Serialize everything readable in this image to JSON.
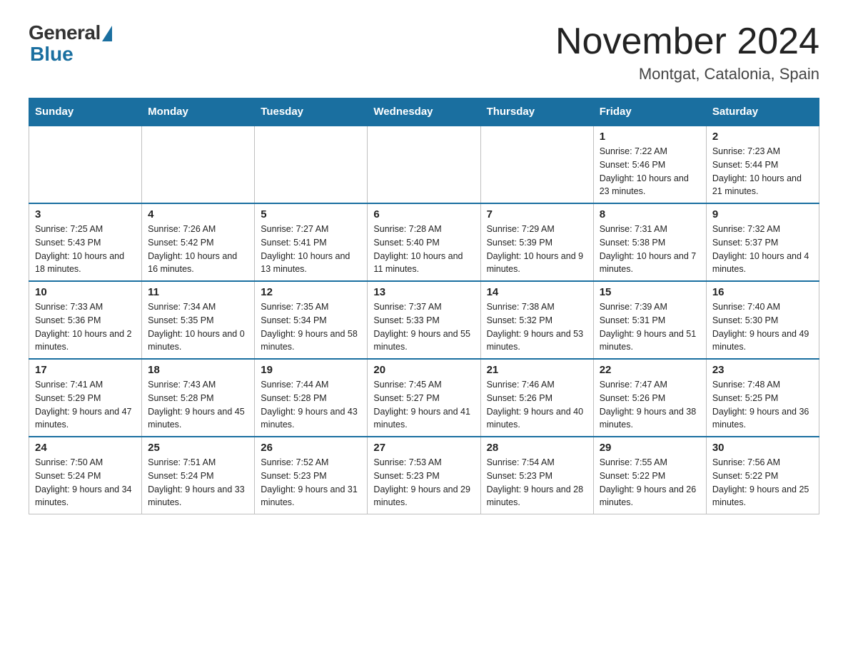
{
  "header": {
    "logo_general": "General",
    "logo_blue": "Blue",
    "main_title": "November 2024",
    "subtitle": "Montgat, Catalonia, Spain"
  },
  "calendar": {
    "days_of_week": [
      "Sunday",
      "Monday",
      "Tuesday",
      "Wednesday",
      "Thursday",
      "Friday",
      "Saturday"
    ],
    "weeks": [
      [
        {
          "day": "",
          "info": ""
        },
        {
          "day": "",
          "info": ""
        },
        {
          "day": "",
          "info": ""
        },
        {
          "day": "",
          "info": ""
        },
        {
          "day": "",
          "info": ""
        },
        {
          "day": "1",
          "info": "Sunrise: 7:22 AM\nSunset: 5:46 PM\nDaylight: 10 hours and 23 minutes."
        },
        {
          "day": "2",
          "info": "Sunrise: 7:23 AM\nSunset: 5:44 PM\nDaylight: 10 hours and 21 minutes."
        }
      ],
      [
        {
          "day": "3",
          "info": "Sunrise: 7:25 AM\nSunset: 5:43 PM\nDaylight: 10 hours and 18 minutes."
        },
        {
          "day": "4",
          "info": "Sunrise: 7:26 AM\nSunset: 5:42 PM\nDaylight: 10 hours and 16 minutes."
        },
        {
          "day": "5",
          "info": "Sunrise: 7:27 AM\nSunset: 5:41 PM\nDaylight: 10 hours and 13 minutes."
        },
        {
          "day": "6",
          "info": "Sunrise: 7:28 AM\nSunset: 5:40 PM\nDaylight: 10 hours and 11 minutes."
        },
        {
          "day": "7",
          "info": "Sunrise: 7:29 AM\nSunset: 5:39 PM\nDaylight: 10 hours and 9 minutes."
        },
        {
          "day": "8",
          "info": "Sunrise: 7:31 AM\nSunset: 5:38 PM\nDaylight: 10 hours and 7 minutes."
        },
        {
          "day": "9",
          "info": "Sunrise: 7:32 AM\nSunset: 5:37 PM\nDaylight: 10 hours and 4 minutes."
        }
      ],
      [
        {
          "day": "10",
          "info": "Sunrise: 7:33 AM\nSunset: 5:36 PM\nDaylight: 10 hours and 2 minutes."
        },
        {
          "day": "11",
          "info": "Sunrise: 7:34 AM\nSunset: 5:35 PM\nDaylight: 10 hours and 0 minutes."
        },
        {
          "day": "12",
          "info": "Sunrise: 7:35 AM\nSunset: 5:34 PM\nDaylight: 9 hours and 58 minutes."
        },
        {
          "day": "13",
          "info": "Sunrise: 7:37 AM\nSunset: 5:33 PM\nDaylight: 9 hours and 55 minutes."
        },
        {
          "day": "14",
          "info": "Sunrise: 7:38 AM\nSunset: 5:32 PM\nDaylight: 9 hours and 53 minutes."
        },
        {
          "day": "15",
          "info": "Sunrise: 7:39 AM\nSunset: 5:31 PM\nDaylight: 9 hours and 51 minutes."
        },
        {
          "day": "16",
          "info": "Sunrise: 7:40 AM\nSunset: 5:30 PM\nDaylight: 9 hours and 49 minutes."
        }
      ],
      [
        {
          "day": "17",
          "info": "Sunrise: 7:41 AM\nSunset: 5:29 PM\nDaylight: 9 hours and 47 minutes."
        },
        {
          "day": "18",
          "info": "Sunrise: 7:43 AM\nSunset: 5:28 PM\nDaylight: 9 hours and 45 minutes."
        },
        {
          "day": "19",
          "info": "Sunrise: 7:44 AM\nSunset: 5:28 PM\nDaylight: 9 hours and 43 minutes."
        },
        {
          "day": "20",
          "info": "Sunrise: 7:45 AM\nSunset: 5:27 PM\nDaylight: 9 hours and 41 minutes."
        },
        {
          "day": "21",
          "info": "Sunrise: 7:46 AM\nSunset: 5:26 PM\nDaylight: 9 hours and 40 minutes."
        },
        {
          "day": "22",
          "info": "Sunrise: 7:47 AM\nSunset: 5:26 PM\nDaylight: 9 hours and 38 minutes."
        },
        {
          "day": "23",
          "info": "Sunrise: 7:48 AM\nSunset: 5:25 PM\nDaylight: 9 hours and 36 minutes."
        }
      ],
      [
        {
          "day": "24",
          "info": "Sunrise: 7:50 AM\nSunset: 5:24 PM\nDaylight: 9 hours and 34 minutes."
        },
        {
          "day": "25",
          "info": "Sunrise: 7:51 AM\nSunset: 5:24 PM\nDaylight: 9 hours and 33 minutes."
        },
        {
          "day": "26",
          "info": "Sunrise: 7:52 AM\nSunset: 5:23 PM\nDaylight: 9 hours and 31 minutes."
        },
        {
          "day": "27",
          "info": "Sunrise: 7:53 AM\nSunset: 5:23 PM\nDaylight: 9 hours and 29 minutes."
        },
        {
          "day": "28",
          "info": "Sunrise: 7:54 AM\nSunset: 5:23 PM\nDaylight: 9 hours and 28 minutes."
        },
        {
          "day": "29",
          "info": "Sunrise: 7:55 AM\nSunset: 5:22 PM\nDaylight: 9 hours and 26 minutes."
        },
        {
          "day": "30",
          "info": "Sunrise: 7:56 AM\nSunset: 5:22 PM\nDaylight: 9 hours and 25 minutes."
        }
      ]
    ]
  }
}
